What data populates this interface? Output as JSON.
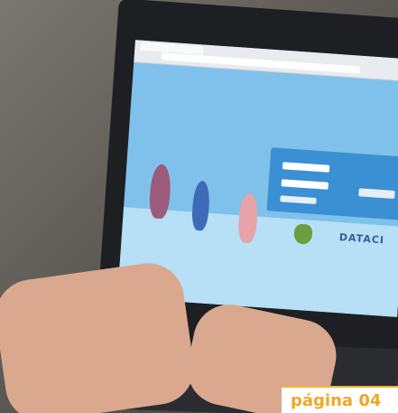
{
  "photo": {
    "description_icon": "laptop-photo-icon",
    "screen": {
      "browser": {
        "tab_label": "",
        "address_label": "",
        "bookmarks_label": ""
      },
      "logo": {
        "brand": "",
        "tagline": ""
      },
      "login": {
        "field1_label": "",
        "field1_value": "",
        "field2_label": "",
        "field2_value": "",
        "submit_label": "",
        "alt_button_label": ""
      },
      "partners": {
        "dataci_label": "DATACI"
      }
    }
  },
  "footer": {
    "page_label": "página 04"
  },
  "colors": {
    "accent": "#f2a52a",
    "screen_bg": "#7fc1ea"
  }
}
